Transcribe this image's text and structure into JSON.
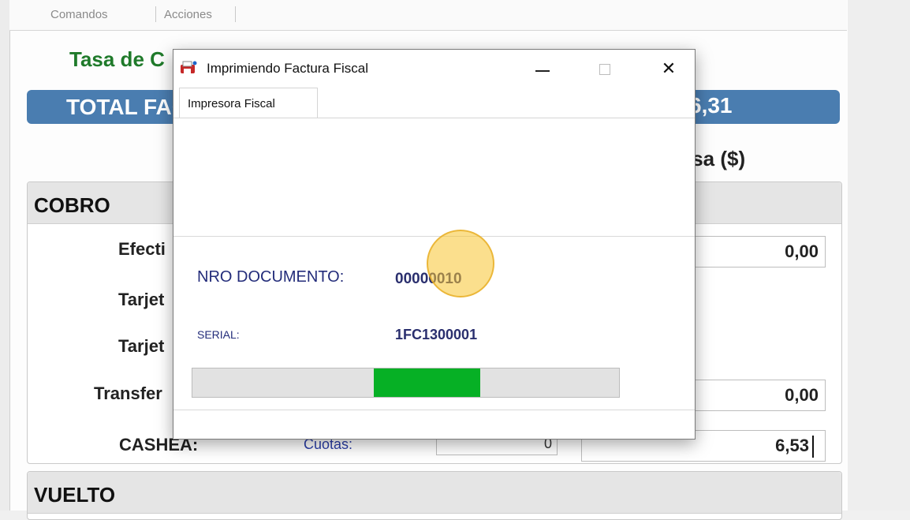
{
  "menu": {
    "items": [
      {
        "label": "Comandos"
      },
      {
        "label": "Acciones"
      }
    ]
  },
  "main": {
    "rate_title": "Tasa de C",
    "total_label": "TOTAL FAC",
    "total_value": "6,31",
    "divisa_label": "isa ($)"
  },
  "cobro": {
    "title": "COBRO",
    "rows": [
      {
        "label": "Efecti",
        "amount": "0,00"
      },
      {
        "label": "Tarjet"
      },
      {
        "label": "Tarjet"
      },
      {
        "label": "Transfer",
        "amount": "0,00"
      },
      {
        "label": "CASHEA:",
        "cuotas_label": "Cuotas:",
        "cuotas_value": "0",
        "amount": "6,53"
      }
    ]
  },
  "vuelto": {
    "title": "VUELTO"
  },
  "dialog": {
    "title": "Imprimiendo Factura Fiscal",
    "tab_label": "Impresora Fiscal",
    "doc_label": "NRO DOCUMENTO:",
    "doc_value": "00000010",
    "serial_label": "SERIAL:",
    "serial_value": "1FC1300001",
    "progress": {
      "start_fraction": 0.425,
      "fill_fraction": 0.25,
      "fill_color": "#06b025"
    },
    "controls": {
      "close_glyph": "✕"
    }
  },
  "colors": {
    "accent_total_bar": "#4a7db0",
    "rate_title": "#1f7a2a",
    "dialog_text": "#232c7a",
    "cursor_highlight": "#f7c430"
  }
}
